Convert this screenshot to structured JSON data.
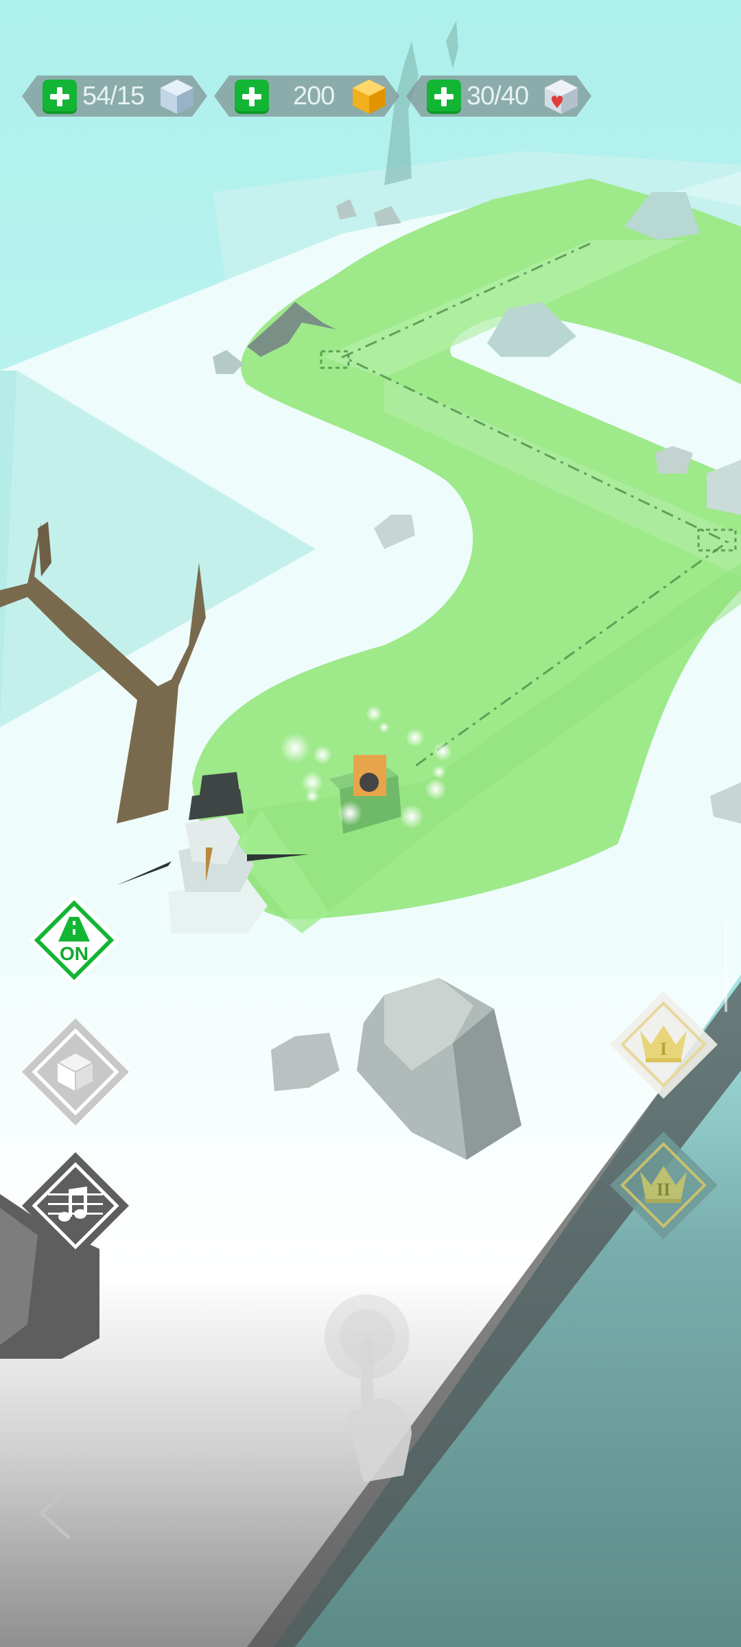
{
  "hud": {
    "blocks": {
      "value": "54/15",
      "icon": "ice-cube-icon"
    },
    "gems": {
      "value": "200",
      "icon": "gold-gem-icon"
    },
    "lives": {
      "value": "30/40",
      "icon": "heart-cube-icon"
    }
  },
  "menu": {
    "track_toggle": {
      "label": "ON",
      "icon": "road-icon"
    },
    "skins": {
      "icon": "cube-icon"
    },
    "music": {
      "icon": "music-note-icon"
    }
  },
  "right_menu": {
    "crown_one": {
      "label": "I",
      "icon": "crown-icon"
    },
    "crown_two": {
      "label": "II",
      "icon": "crown-icon"
    }
  },
  "navigation": {
    "back": {
      "icon": "chevron-left-icon"
    }
  },
  "hint": {
    "icon": "tap-finger-icon"
  },
  "colors": {
    "sky": "#b3efec",
    "snow": "#eefcfb",
    "grass": "#9ee98a",
    "accent_green": "#13b535",
    "gold": "#e8c94a"
  }
}
